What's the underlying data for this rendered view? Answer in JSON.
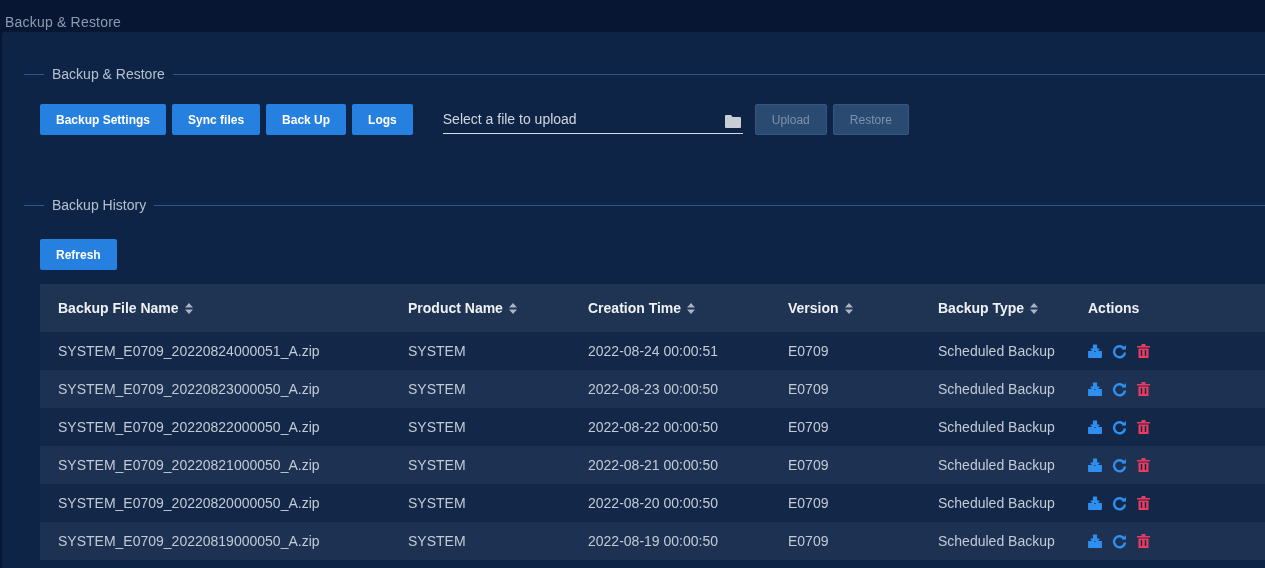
{
  "page_title": "Backup & Restore",
  "restore_section": {
    "legend": "Backup & Restore",
    "buttons": [
      {
        "label": "Backup Settings",
        "disabled": false
      },
      {
        "label": "Sync files",
        "disabled": false
      },
      {
        "label": "Back Up",
        "disabled": false
      },
      {
        "label": "Logs",
        "disabled": false
      }
    ],
    "file_field": {
      "placeholder": "Select a file to upload"
    },
    "file_buttons": [
      {
        "label": "Upload",
        "disabled": true
      },
      {
        "label": "Restore",
        "disabled": true
      }
    ]
  },
  "history_section": {
    "legend": "Backup History",
    "refresh_button": "Refresh",
    "table": {
      "columns": [
        {
          "label": "Backup File Name",
          "sortable": true
        },
        {
          "label": "Product Name",
          "sortable": true
        },
        {
          "label": "Creation Time",
          "sortable": true
        },
        {
          "label": "Version",
          "sortable": true
        },
        {
          "label": "Backup Type",
          "sortable": true
        },
        {
          "label": "Actions",
          "sortable": false
        }
      ],
      "rows": [
        [
          "SYSTEM_E0709_20220824000051_A.zip",
          "SYSTEM",
          "2022-08-24 00:00:51",
          "E0709",
          "Scheduled Backup"
        ],
        [
          "SYSTEM_E0709_20220823000050_A.zip",
          "SYSTEM",
          "2022-08-23 00:00:50",
          "E0709",
          "Scheduled Backup"
        ],
        [
          "SYSTEM_E0709_20220822000050_A.zip",
          "SYSTEM",
          "2022-08-22 00:00:50",
          "E0709",
          "Scheduled Backup"
        ],
        [
          "SYSTEM_E0709_20220821000050_A.zip",
          "SYSTEM",
          "2022-08-21 00:00:50",
          "E0709",
          "Scheduled Backup"
        ],
        [
          "SYSTEM_E0709_20220820000050_A.zip",
          "SYSTEM",
          "2022-08-20 00:00:50",
          "E0709",
          "Scheduled Backup"
        ],
        [
          "SYSTEM_E0709_20220819000050_A.zip",
          "SYSTEM",
          "2022-08-19 00:00:50",
          "E0709",
          "Scheduled Backup"
        ]
      ]
    }
  }
}
